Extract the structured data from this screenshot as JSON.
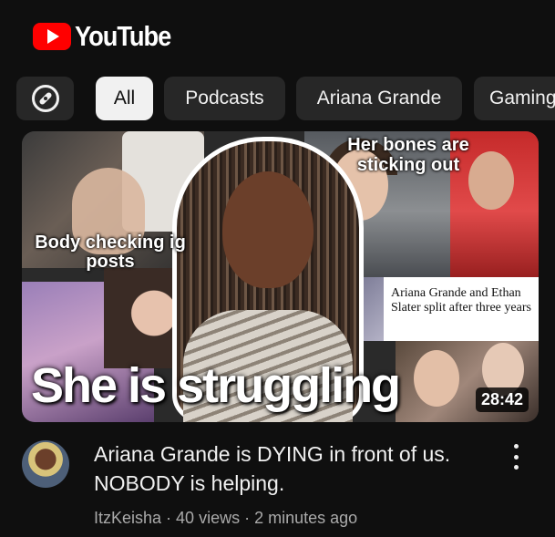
{
  "header": {
    "logo_text": "YouTube"
  },
  "chips": {
    "explore_icon": "compass-icon",
    "items": [
      {
        "label": "All",
        "active": true
      },
      {
        "label": "Podcasts",
        "active": false
      },
      {
        "label": "Ariana Grande",
        "active": false
      },
      {
        "label": "Gaming",
        "active": false
      }
    ]
  },
  "video": {
    "thumbnail": {
      "overlay_top_left": "Body checking ig posts",
      "overlay_top_right": "Her bones are sticking out",
      "news_headline": "Ariana Grande and Ethan Slater split after three years",
      "overlay_main": "She is struggling",
      "duration": "28:42"
    },
    "title": "Ariana Grande is DYING in front of us. NOBODY is helping.",
    "channel": "ItzKeisha",
    "views": "40 views",
    "time_ago": "2 minutes ago",
    "separator": " · ",
    "more_icon": "more-vert-icon"
  },
  "colors": {
    "background": "#0f0f0f",
    "chip": "#272727",
    "chip_active": "#f1f1f1",
    "brand_red": "#ff0000",
    "secondary_text": "#aaaaaa"
  }
}
